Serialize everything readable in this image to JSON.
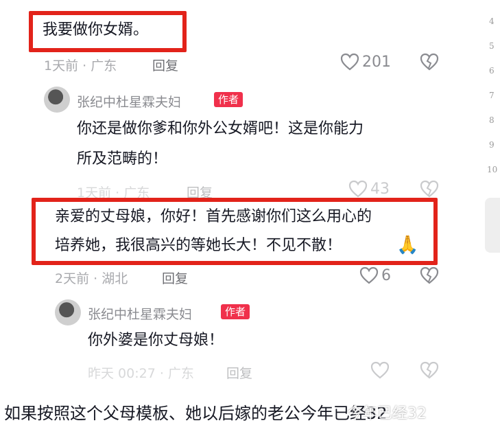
{
  "comments": [
    {
      "text": "我要做你女婿。",
      "meta": "1天前 · 广东",
      "reply": "回复",
      "likes": "201",
      "replies": [
        {
          "user": "张纪中杜星霖夫妇",
          "badge": "作者",
          "text_line1": "你还是做你爹和你外公女婿吧！这是你能力",
          "text_line2": "所及范畴的！",
          "meta": "1天前 · 广东",
          "reply": "回复",
          "likes": "43"
        }
      ]
    },
    {
      "text_line1": "亲爱的丈母娘，你好！首先感谢你们这么用心的",
      "text_line2": "培养她，我很高兴的等她长大！不见不散！",
      "emoji": "🙏",
      "meta": "2天前 · 湖北",
      "reply": "回复",
      "likes": "6",
      "replies": [
        {
          "user": "张纪中杜星霖夫妇",
          "badge": "作者",
          "text": "你外婆是你丈母娘！",
          "meta": "昨天 00:27 · 广东",
          "reply": "回复"
        }
      ]
    }
  ],
  "side_line_numbers": [
    "4",
    "5",
    "6",
    "7",
    "8",
    "9",
    "10"
  ],
  "caption": "如果按照这个父母模板、她以后嫁的老公今年已经32",
  "watermark": "今年已经32",
  "colors": {
    "highlight_box": "#e2231a",
    "author_badge": "#f0304b"
  },
  "icons": [
    "heart-icon",
    "broken-heart-icon",
    "pray-emoji-icon"
  ]
}
